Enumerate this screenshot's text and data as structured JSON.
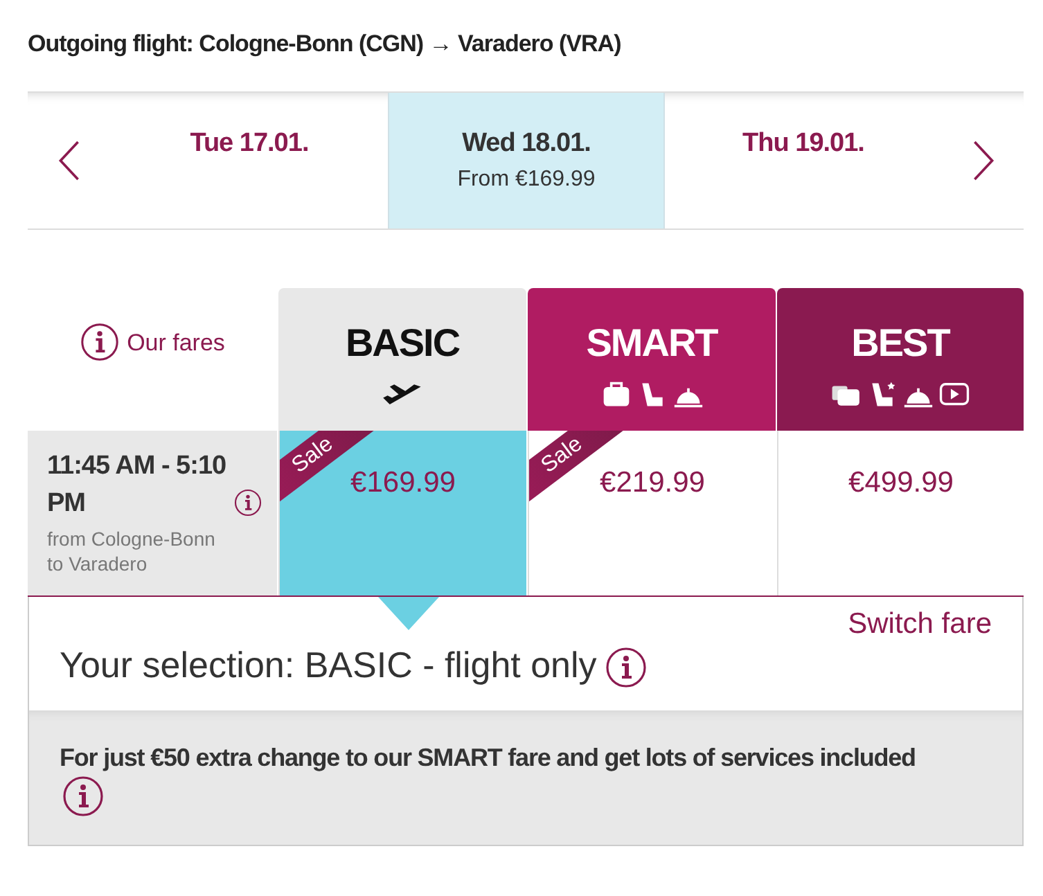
{
  "heading": "Outgoing flight: Cologne-Bonn (CGN) → Varadero (VRA)",
  "dates": [
    {
      "label": "Tue 17.01.",
      "selected": false
    },
    {
      "label": "Wed 18.01.",
      "price": "From €169.99",
      "selected": true
    },
    {
      "label": "Thu 19.01.",
      "selected": false
    }
  ],
  "fares_label": "Our fares",
  "fares": [
    {
      "name": "BASIC",
      "kind": "basic",
      "price": "€169.99",
      "sale": "Sale",
      "selected": true
    },
    {
      "name": "SMART",
      "kind": "smart",
      "price": "€219.99",
      "sale": "Sale",
      "selected": false
    },
    {
      "name": "BEST",
      "kind": "best",
      "price": "€499.99",
      "selected": false
    }
  ],
  "flight": {
    "time": "11:45 AM - 5:10 PM",
    "route": "from Cologne-Bonn to Varadero"
  },
  "switch_link": "Switch fare",
  "selection": "Your selection: BASIC - flight only",
  "upsell": "For just €50 extra change to our SMART fare and get lots of services included"
}
